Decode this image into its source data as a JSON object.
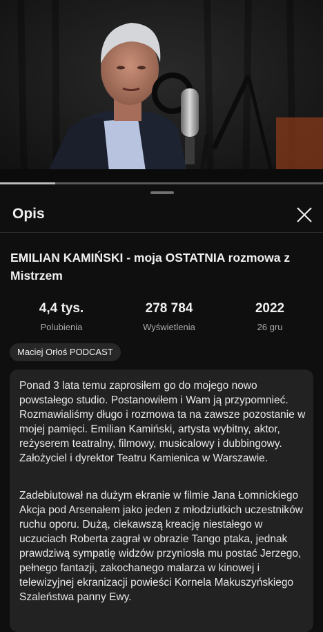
{
  "video": {
    "progress_fraction": 0.17,
    "scene": "man speaking into studio microphone"
  },
  "panel": {
    "header_title": "Opis",
    "close_icon": "close-icon"
  },
  "video_title": "EMILIAN KAMIŃSKI - moja OSTATNIA rozmowa z Mistrzem",
  "stats": {
    "likes_value": "4,4 tys.",
    "likes_label": "Polubienia",
    "views_value": "278 784",
    "views_label": "Wyświetlenia",
    "year_value": "2022",
    "date_label": "26 gru"
  },
  "channel": {
    "name": "Maciej Orłoś PODCAST"
  },
  "description": {
    "paragraph1": "Ponad 3 lata temu zaprosiłem go do mojego nowo powstałego studio. Postanowiłem i Wam ją przypomnieć. Rozmawialiśmy długo i rozmowa ta na zawsze pozostanie w mojej pamięci. Emilian Kamiński, artysta wybitny, aktor, reżyserem teatralny, filmowy, musicalowy i dubbingowy. Założyciel i dyrektor  Teatru Kamienica w Warszawie.",
    "paragraph2": "Zadebiutował na dużym ekranie w filmie Jana Łomnickiego Akcja pod Arsenałem jako jeden z młodziutkich uczestników ruchu oporu. Dużą, ciekawszą kreację niestałego w uczuciach Roberta zagrał w obrazie Tango ptaka, jednak prawdziwą sympatię widzów przyniosła mu postać Jerzego, pełnego fantazji, zakochanego malarza w kinowej i telewizyjnej ekranizacji powieści Kornela Makuszyńskiego Szaleństwa panny Ewy."
  },
  "colors": {
    "background": "#0f0f0f",
    "surface": "#222222",
    "chip": "#272727",
    "text_primary": "#f1f1f1",
    "text_secondary": "#aaaaaa"
  }
}
